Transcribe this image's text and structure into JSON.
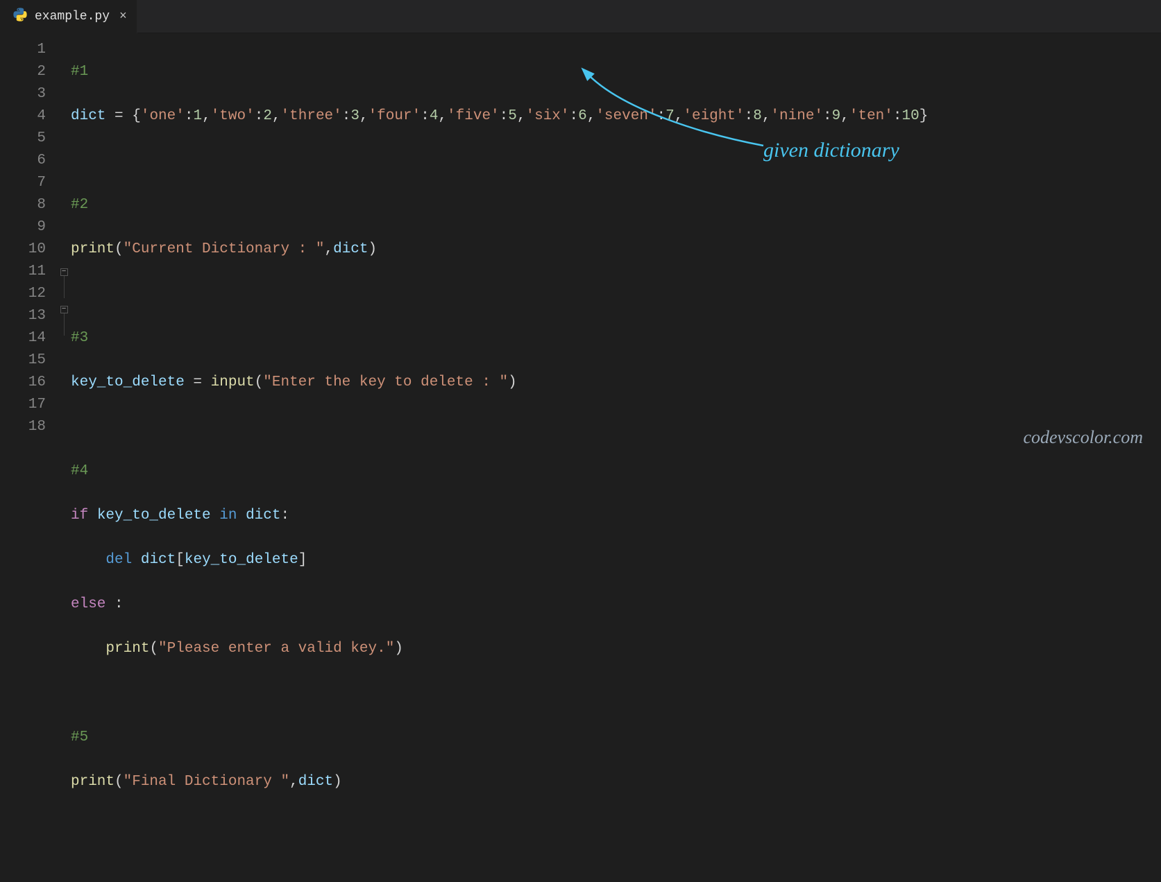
{
  "tab": {
    "filename": "example.py",
    "close_glyph": "×"
  },
  "gutter_lines": [
    "1",
    "2",
    "3",
    "4",
    "5",
    "6",
    "7",
    "8",
    "9",
    "10",
    "11",
    "12",
    "13",
    "14",
    "15",
    "16",
    "17",
    "18"
  ],
  "code": {
    "l1": "#1",
    "l2_a": "dict",
    "l2_b": " = {",
    "l2_pairs": [
      {
        "k": "'one'",
        "v": "1"
      },
      {
        "k": "'two'",
        "v": "2"
      },
      {
        "k": "'three'",
        "v": "3"
      },
      {
        "k": "'four'",
        "v": "4"
      },
      {
        "k": "'five'",
        "v": "5"
      },
      {
        "k": "'six'",
        "v": "6"
      },
      {
        "k": "'seven'",
        "v": "7"
      },
      {
        "k": "'eight'",
        "v": "8"
      },
      {
        "k": "'nine'",
        "v": "9"
      },
      {
        "k": "'ten'",
        "v": "10"
      }
    ],
    "l2_c": "}",
    "l4": "#2",
    "l5_func": "print",
    "l5_open": "(",
    "l5_str": "\"Current Dictionary : \"",
    "l5_comma": ",",
    "l5_arg": "dict",
    "l5_close": ")",
    "l7": "#3",
    "l8_var": "key_to_delete",
    "l8_eq": " = ",
    "l8_func": "input",
    "l8_open": "(",
    "l8_str": "\"Enter the key to delete : \"",
    "l8_close": ")",
    "l10": "#4",
    "l11_if": "if ",
    "l11_var": "key_to_delete",
    "l11_in": " in ",
    "l11_dict": "dict",
    "l11_colon": ":",
    "l12_del": "del ",
    "l12_dict": "dict",
    "l12_open": "[",
    "l12_key": "key_to_delete",
    "l12_close": "]",
    "l13_else": "else ",
    "l13_colon": ":",
    "l14_func": "print",
    "l14_open": "(",
    "l14_str": "\"Please enter a valid key.\"",
    "l14_close": ")",
    "l16": "#5",
    "l17_func": "print",
    "l17_open": "(",
    "l17_str": "\"Final Dictionary \"",
    "l17_comma": ",",
    "l17_arg": "dict",
    "l17_close": ")"
  },
  "annotation": {
    "text": "given dictionary"
  },
  "watermark": {
    "text": "codevscolor.com"
  }
}
